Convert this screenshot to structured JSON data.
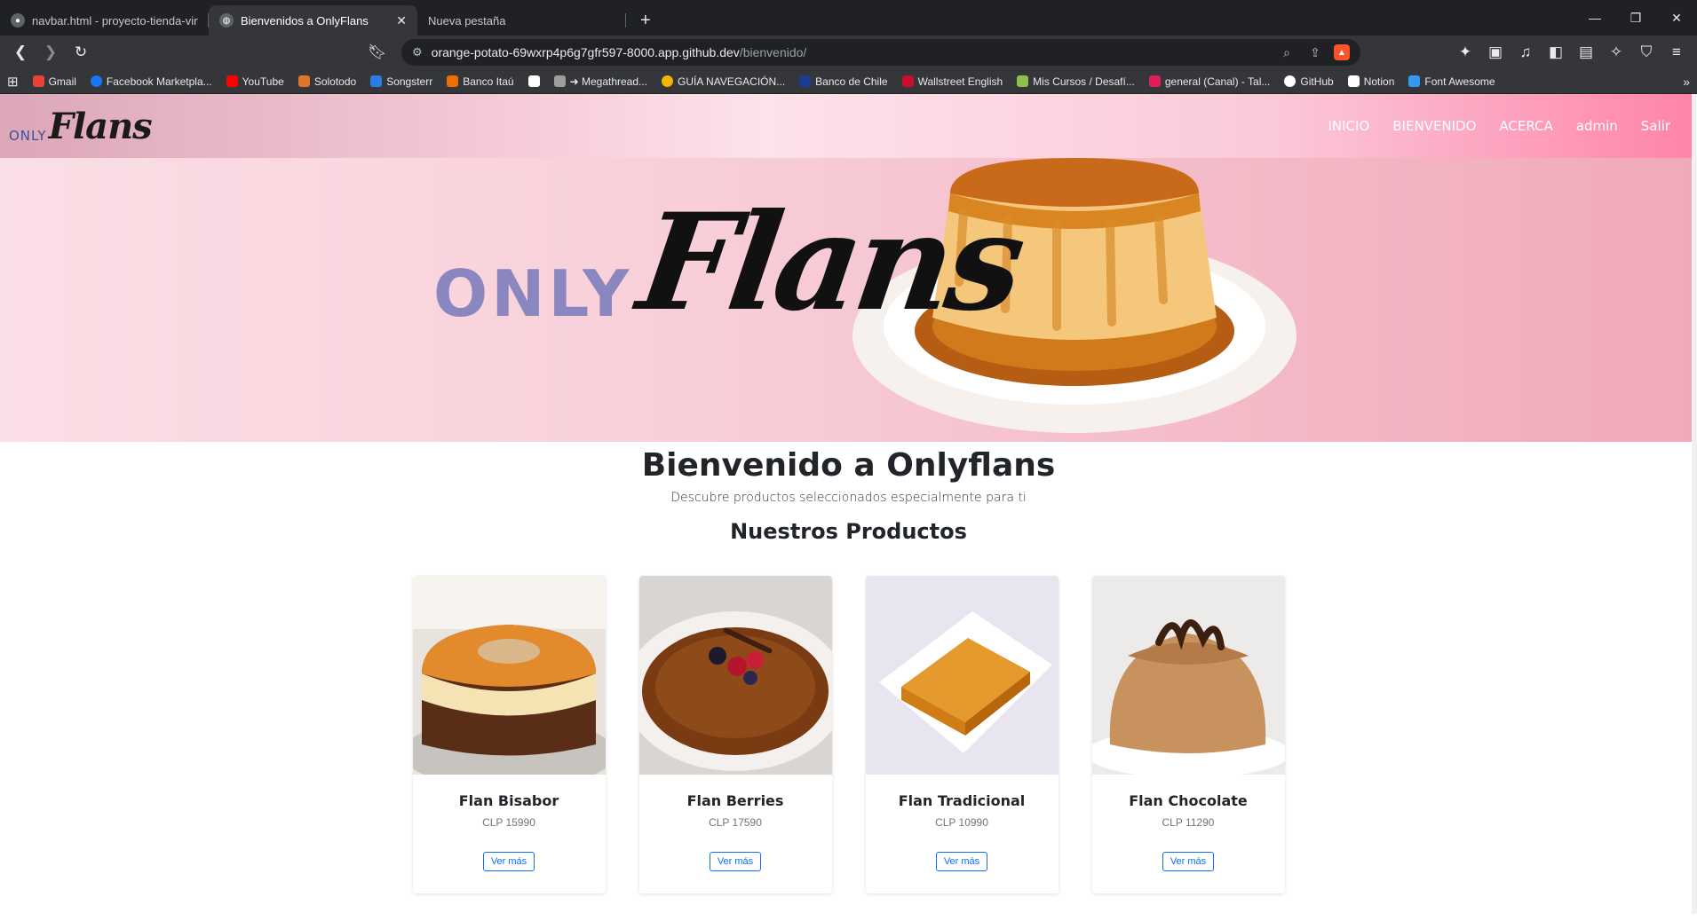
{
  "browser": {
    "tabs": [
      {
        "title": "navbar.html - proyecto-tienda-virtual",
        "active": false
      },
      {
        "title": "Bienvenidos a OnlyFlans",
        "active": true
      },
      {
        "title": "Nueva pestaña",
        "active": false
      }
    ],
    "new_tab_icon": "+",
    "url_host": "orange-potato-69wxrp4p6g7gfr597-8000.app.github.dev",
    "url_path": "/bienvenido/",
    "bookmarks": [
      {
        "label": "Gmail",
        "color": "#ea4335"
      },
      {
        "label": "Facebook Marketpla...",
        "color": "#1877f2"
      },
      {
        "label": "YouTube",
        "color": "#ff0000"
      },
      {
        "label": "Solotodo",
        "color": "#e0762c"
      },
      {
        "label": "Songsterr",
        "color": "#2a7de1"
      },
      {
        "label": "Banco Itaú",
        "color": "#ec7000"
      },
      {
        "label": "",
        "color": "#ffffff"
      },
      {
        "label": "➜ Megathread...",
        "color": "#9e9e9e"
      },
      {
        "label": "GUÍA NAVEGACIÓN...",
        "color": "#f4b400"
      },
      {
        "label": "Banco de Chile",
        "color": "#1a3d8f"
      },
      {
        "label": "Wallstreet English",
        "color": "#c8102e"
      },
      {
        "label": "Mis Cursos / Desafí...",
        "color": "#8bc34a"
      },
      {
        "label": "general (Canal) - Tal...",
        "color": "#e01e5a"
      },
      {
        "label": "GitHub",
        "color": "#ffffff"
      },
      {
        "label": "Notion",
        "color": "#ffffff"
      },
      {
        "label": "Font Awesome",
        "color": "#339af0"
      }
    ]
  },
  "navbar": {
    "brand_only": "ONLY",
    "brand_flans": "Flans",
    "links": [
      "INICIO",
      "BIENVENIDO",
      "ACERCA",
      "admin",
      "Salir"
    ]
  },
  "hero": {
    "only": "ONLY",
    "flans": "Flans"
  },
  "main": {
    "title": "Bienvenido a Onlyflans",
    "subtitle": "Descubre productos seleccionados especialmente para ti",
    "products_heading": "Nuestros Productos",
    "products": [
      {
        "name": "Flan Bisabor",
        "price": "CLP 15990",
        "button": "Ver más",
        "image": "flan-bisabor"
      },
      {
        "name": "Flan Berries",
        "price": "CLP 17590",
        "button": "Ver más",
        "image": "flan-berries"
      },
      {
        "name": "Flan Tradicional",
        "price": "CLP 10990",
        "button": "Ver más",
        "image": "flan-tradicional"
      },
      {
        "name": "Flan Chocolate",
        "price": "CLP 11290",
        "button": "Ver más",
        "image": "flan-chocolate"
      }
    ]
  }
}
